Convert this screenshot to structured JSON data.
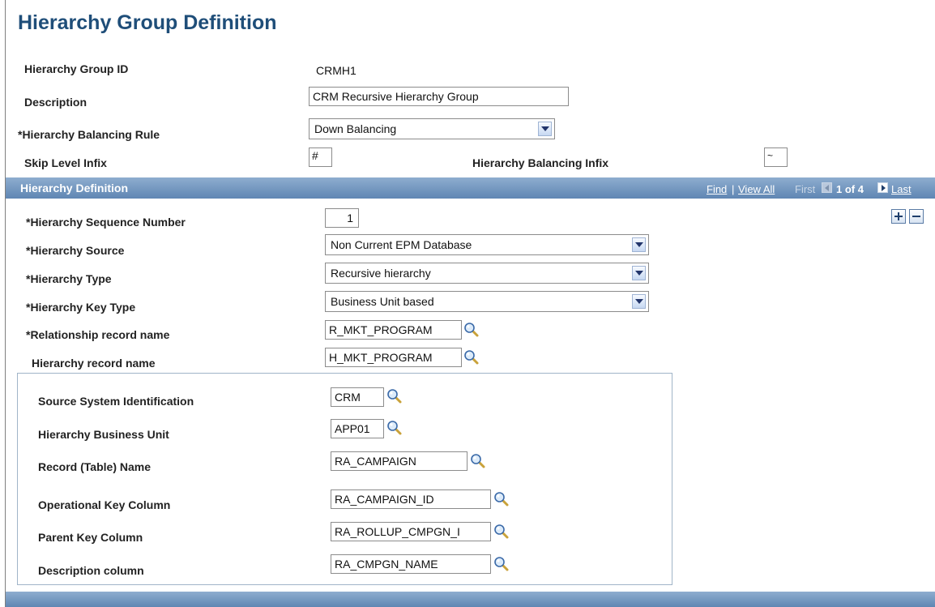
{
  "page": {
    "title": "Hierarchy Group Definition"
  },
  "header_fields": {
    "group_id_label": "Hierarchy Group ID",
    "group_id_value": "CRMH1",
    "description_label": "Description",
    "description_value": "CRM Recursive Hierarchy Group",
    "balancing_rule_label": "*Hierarchy Balancing Rule",
    "balancing_rule_value": "Down Balancing",
    "skip_level_label": "Skip Level Infix",
    "skip_level_value": "#",
    "balancing_infix_label": "Hierarchy Balancing Infix",
    "balancing_infix_value": "~"
  },
  "section": {
    "title": "Hierarchy Definition",
    "nav": {
      "find": "Find",
      "separator": "|",
      "view_all": "View All",
      "first": "First",
      "count": "1 of 4",
      "last": "Last"
    }
  },
  "definition": {
    "seq_label": "*Hierarchy Sequence Number",
    "seq_value": "1",
    "source_label": "*Hierarchy Source",
    "source_value": "Non Current EPM Database",
    "type_label": "*Hierarchy Type",
    "type_value": "Recursive hierarchy",
    "key_type_label": "*Hierarchy Key Type",
    "key_type_value": "Business Unit based",
    "rel_record_label": "*Relationship record name",
    "rel_record_value": "R_MKT_PROGRAM",
    "hier_record_label": "Hierarchy record name",
    "hier_record_value": "H_MKT_PROGRAM"
  },
  "group": {
    "source_system_label": "Source System Identification",
    "source_system_value": "CRM",
    "business_unit_label": "Hierarchy Business Unit",
    "business_unit_value": "APP01",
    "record_name_label": "Record (Table) Name",
    "record_name_value": "RA_CAMPAIGN",
    "op_key_label": "Operational Key Column",
    "op_key_value": "RA_CAMPAIGN_ID",
    "parent_key_label": "Parent Key Column",
    "parent_key_value": "RA_ROLLUP_CMPGN_I",
    "desc_col_label": "Description column",
    "desc_col_value": "RA_CMPGN_NAME"
  },
  "icons": {
    "lookup": "magnifier-icon",
    "dropdown": "chevron-down-icon",
    "add_row": "plus-icon",
    "delete_row": "minus-icon",
    "prev": "arrow-left-icon",
    "next": "arrow-right-icon"
  },
  "colors": {
    "title": "#1f4e79",
    "section_bar": "#6f93bd",
    "border": "#a0b4c8"
  }
}
